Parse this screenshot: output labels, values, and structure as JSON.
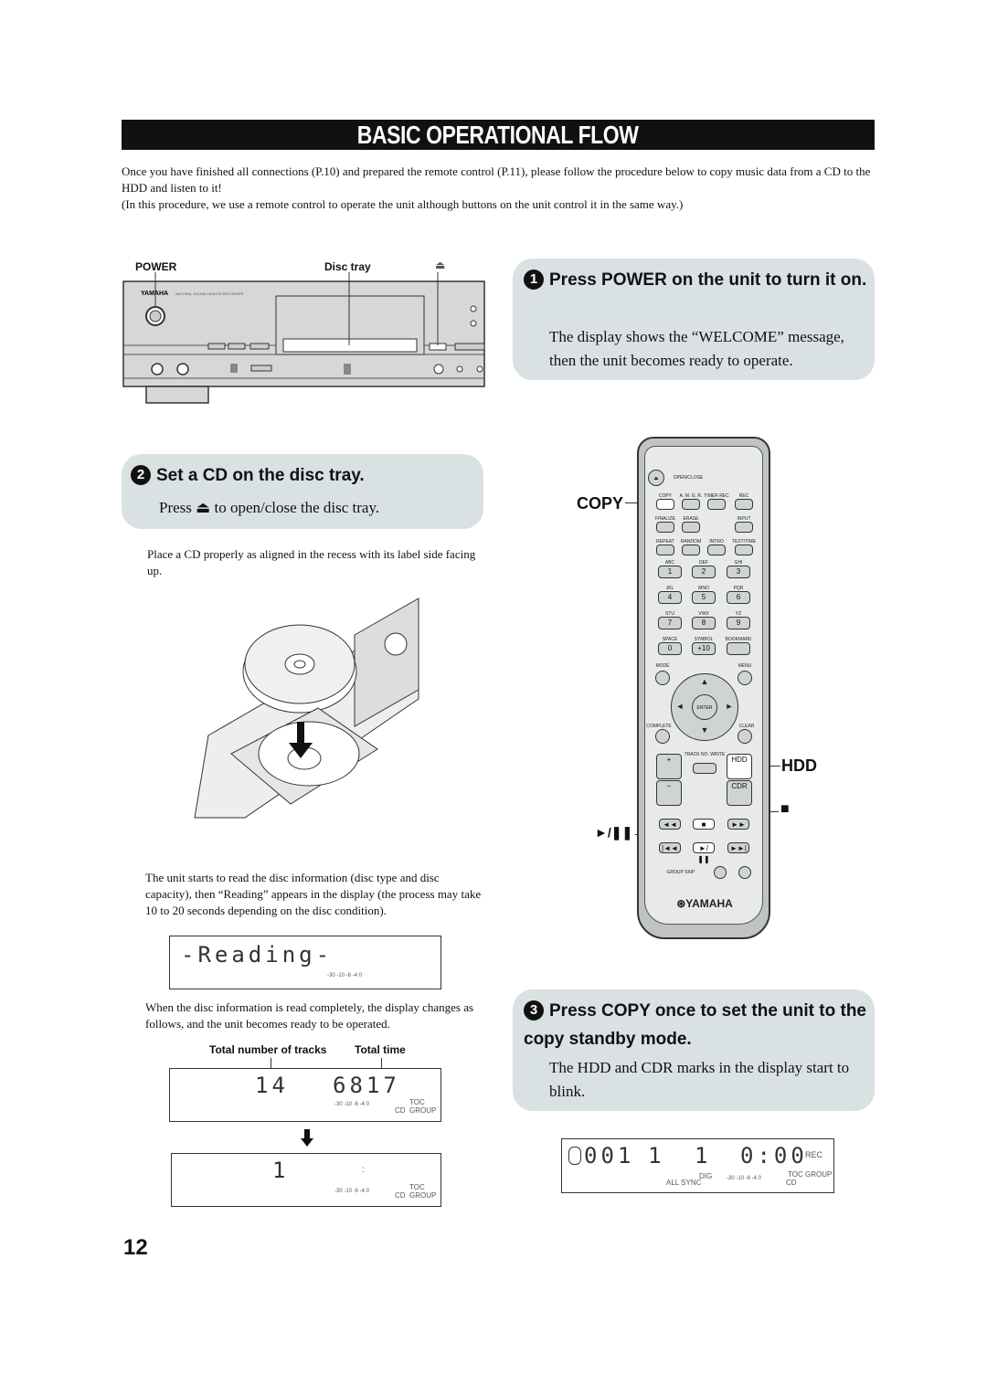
{
  "title": "BASIC OPERATIONAL FLOW",
  "intro": {
    "p1": "Once you have finished all connections (P.10) and prepared the remote control (P.11), please follow the procedure below to copy music data from a CD to the HDD and listen to it!",
    "p2": "(In this procedure, we use a remote control to operate the unit although buttons on the unit control it in the same way.)"
  },
  "front_panel": {
    "power_label": "POWER",
    "disc_tray_label": "Disc tray",
    "eject_symbol": "⏏",
    "brand": "YAMAHA",
    "model_text": "NATURAL SOUND HDD/CD RECORDER"
  },
  "steps": [
    {
      "number": "1",
      "title": "Press POWER on the unit to turn it on.",
      "body": "The display shows the “WELCOME” message, then the unit becomes ready to operate."
    },
    {
      "number": "2",
      "title": "Set a CD on the disc tray.",
      "body_pre": "Press",
      "body_symbol": "⏏",
      "body_post": "to open/close the disc tray."
    },
    {
      "number": "3",
      "title": "Press COPY once to set the unit to the copy standby mode.",
      "body": "The HDD and CDR marks in the display start to blink."
    }
  ],
  "step2_notes": {
    "place_cd": "Place a CD properly as aligned in the recess with its label side facing up.",
    "reading": "The unit starts to read the disc information (disc type and disc capacity), then “Reading” appears in the display (the process may take 10 to 20 seconds depending on the disc condition).",
    "complete": "When the disc information is read completely, the display changes as follows, and the unit becomes ready to be operated.",
    "label_tracks": "Total number of tracks",
    "label_time": "Total time"
  },
  "displays": {
    "reading": {
      "text": "-Reading-",
      "meter": "-30 -10 -6 -4 0"
    },
    "summary": {
      "tracks": "14",
      "time": "6817",
      "meter": "-30 -10 -6 -4 0",
      "tags": "TOC GROUP",
      "cd": "CD"
    },
    "ready": {
      "track": "1",
      "colon": ":",
      "meter": "-30 -10 -6 -4 0",
      "tags": "TOC GROUP",
      "cd": "CD"
    },
    "copy": {
      "left": "001",
      "track": "1",
      "track2": "1",
      "time": "0:00",
      "rec": "REC",
      "dig": "DIG",
      "allsync": "ALL SYNC",
      "meter": "-30 -10 -6 -4 0",
      "tags": "TOC GROUP",
      "cd": "CD"
    }
  },
  "remote": {
    "callouts": {
      "copy": "COPY",
      "hdd": "HDD",
      "stop": "■",
      "play_pause": "►/❚❚"
    },
    "open_close": "OPEN/CLOSE",
    "func_rows": [
      [
        "COPY",
        "A. M. G. R.",
        "TIMER REC",
        "REC"
      ],
      [
        "FINALIZE",
        "ERASE",
        "",
        "INPUT"
      ],
      [
        "REPEAT",
        "RANDOM",
        "INTRO",
        "TEXT/TIME"
      ]
    ],
    "digit_rows": [
      {
        "labels": [
          "ABC",
          "DEF",
          "GHI"
        ],
        "keys": [
          "1",
          "2",
          "3"
        ]
      },
      {
        "labels": [
          "JKL",
          "MNO",
          "PQR"
        ],
        "keys": [
          "4",
          "5",
          "6"
        ]
      },
      {
        "labels": [
          "STU",
          "VWX",
          "YZ"
        ],
        "keys": [
          "7",
          "8",
          "9"
        ]
      },
      {
        "labels": [
          "SPACE",
          "SYMBOL",
          "BOOKMARK"
        ],
        "keys": [
          "0",
          "+10",
          ""
        ]
      }
    ],
    "mode": "MODE",
    "menu": "MENU",
    "enter": "ENTER",
    "complete": "COMPLETE",
    "clear": "CLEAR",
    "track_no_write": "TRACK NO. WRITE",
    "plus": "+",
    "minus": "−",
    "hdd": "HDD",
    "cdr": "CDR",
    "transport_row1": [
      "◄◄",
      "■",
      "►►"
    ],
    "transport_row2": [
      "|◄◄",
      "►/❚❚",
      "►►|"
    ],
    "group_skip": "GROUP SKIP",
    "brand": "YAMAHA"
  },
  "page_number": "12"
}
